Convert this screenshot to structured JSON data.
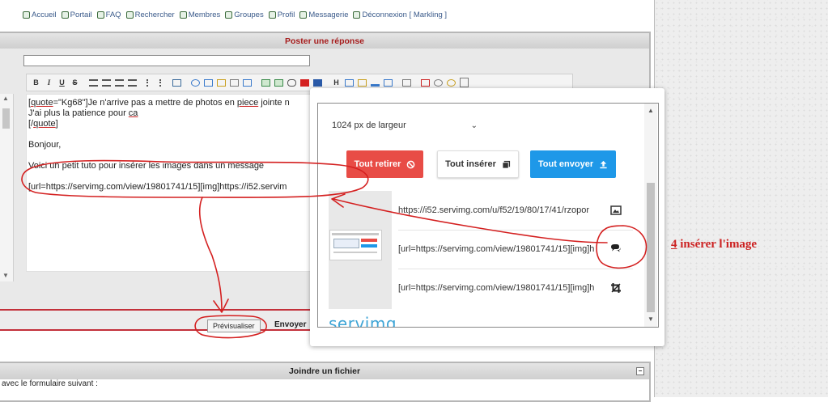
{
  "nav": {
    "items": [
      {
        "label": "Accueil",
        "icon": "home-icon"
      },
      {
        "label": "Portail",
        "icon": "portal-icon"
      },
      {
        "label": "FAQ",
        "icon": "faq-icon"
      },
      {
        "label": "Rechercher",
        "icon": "search-icon"
      },
      {
        "label": "Membres",
        "icon": "members-icon"
      },
      {
        "label": "Groupes",
        "icon": "groups-icon"
      },
      {
        "label": "Profil",
        "icon": "profile-icon"
      },
      {
        "label": "Messagerie",
        "icon": "mail-icon"
      },
      {
        "label": "Déconnexion [ Markling ]",
        "icon": "logout-icon"
      }
    ]
  },
  "post_panel": {
    "title": "Poster une réponse"
  },
  "toolbar": {
    "bold": "B",
    "italic": "I",
    "underline": "U",
    "strike": "S",
    "header": "H"
  },
  "editor": {
    "line1_pre": "[",
    "line1_quote": "quote",
    "line1_mid": "=\"Kg68\"]Je n'arrive pas a mettre de photos en ",
    "line1_piece": "piece",
    "line1_post": "  jointe n",
    "line2_pre": "J'ai plus la  patience pour ",
    "line2_ca": "ca",
    "line3_pre": "[/",
    "line3_quote": "quote",
    "line3_post": "]",
    "line4": "Bonjour,",
    "line5": "Voici un petit tuto pour insérer les images dans un message",
    "line6": "[url=https://servimg.com/view/19801741/15][img]https://i52.servim"
  },
  "actions": {
    "preview": "Prévisualiser",
    "send": "Envoyer"
  },
  "attach_panel": {
    "title": "Joindre un fichier",
    "text": "avec le formulaire suivant :",
    "minimize": "−"
  },
  "servimg": {
    "size_select": "1024 px de largeur",
    "remove_all": "Tout retirer",
    "insert_all": "Tout insérer",
    "send_all": "Tout envoyer",
    "links": [
      {
        "text": "https://i52.servimg.com/u/f52/19/80/17/41/rzopor",
        "icon": "image-icon"
      },
      {
        "text": "[url=https://servimg.com/view/19801741/15][img]h",
        "icon": "insert-bubble-icon"
      },
      {
        "text": "[url=https://servimg.com/view/19801741/15][img]h",
        "icon": "crop-icon"
      }
    ],
    "logo": "servimg"
  },
  "annotation": {
    "number": "4",
    "text": " insérer l'image"
  },
  "colors": {
    "accent_red": "#e84c46",
    "accent_blue": "#1e98e8",
    "ink": "#d42020",
    "panel_title": "#a61c1c"
  }
}
